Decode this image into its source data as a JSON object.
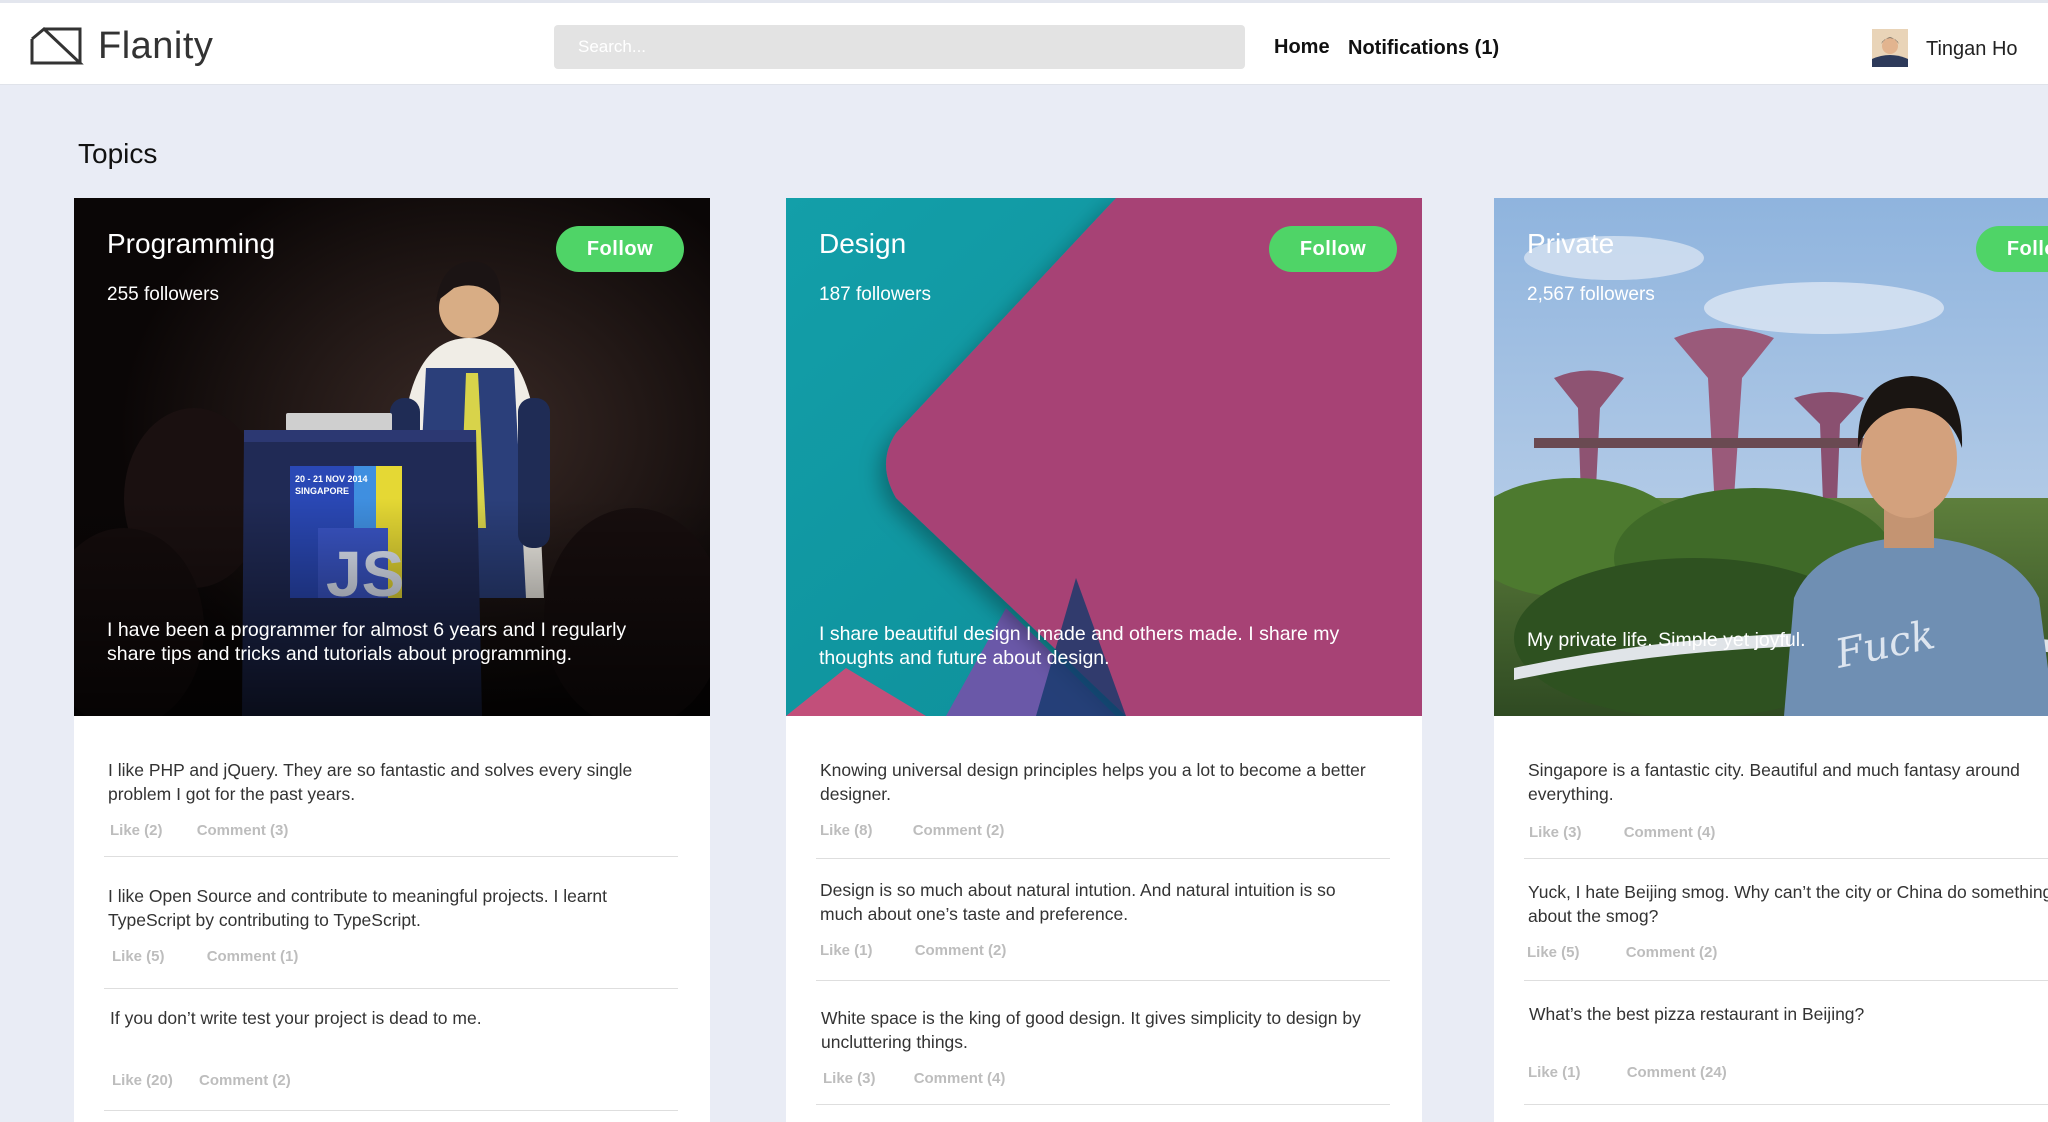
{
  "header": {
    "brand": "Flanity",
    "search_placeholder": "Search...",
    "nav_home": "Home",
    "nav_notifications": "Notifications (1)",
    "user_name": "Tingan Ho"
  },
  "section_title": "Topics",
  "colors": {
    "accent_green": "#4fd467",
    "page_bg": "#e9ecf5",
    "muted_text": "#bdbdbd"
  },
  "topics": [
    {
      "title": "Programming",
      "followers": "255 followers",
      "follow_label": "Follow",
      "description": "I have been a programmer for almost 6 years and I regularly share tips and tricks and tutorials about programming.",
      "hero_banner_text": "20 - 21 NOV 2014 SINGAPORE JS",
      "posts": [
        {
          "text": "I like PHP and jQuery. They are so fantastic and solves every single problem I got for the past years.",
          "like": "Like (2)",
          "comment": "Comment (3)"
        },
        {
          "text": "I like Open Source and contribute to meaningful projects. I learnt TypeScript by contributing to TypeScript.",
          "like": "Like (5)",
          "comment": "Comment (1)"
        },
        {
          "text": "If you don’t write test your project is dead to me.",
          "like": "Like (20)",
          "comment": "Comment (2)"
        }
      ]
    },
    {
      "title": "Design",
      "followers": "187 followers",
      "follow_label": "Follow",
      "description": "I share beautiful design I made and others made. I share my thoughts and future about design.",
      "posts": [
        {
          "text": "Knowing universal design principles helps you a lot to become a better designer.",
          "like": "Like (8)",
          "comment": "Comment (2)"
        },
        {
          "text": "Design is so much about natural intution. And natural intuition is so much about one’s taste and preference.",
          "like": "Like (1)",
          "comment": "Comment (2)"
        },
        {
          "text": "White space is the king of good design. It gives simplicity to design by uncluttering things.",
          "like": "Like (3)",
          "comment": "Comment (4)"
        }
      ]
    },
    {
      "title": "Private",
      "followers": "2,567 followers",
      "follow_label": "Follow",
      "description": "My private life. Simple yet joyful.",
      "posts": [
        {
          "text": "Singapore is a fantastic city. Beautiful and much fantasy around everything.",
          "like": "Like (3)",
          "comment": "Comment (4)"
        },
        {
          "text": "Yuck, I hate Beijing smog. Why can’t the city or China do something about the smog?",
          "like": "Like (5)",
          "comment": "Comment (2)"
        },
        {
          "text": "What’s the best pizza restaurant in Beijing?",
          "like": "Like (1)",
          "comment": "Comment (24)"
        }
      ]
    }
  ]
}
